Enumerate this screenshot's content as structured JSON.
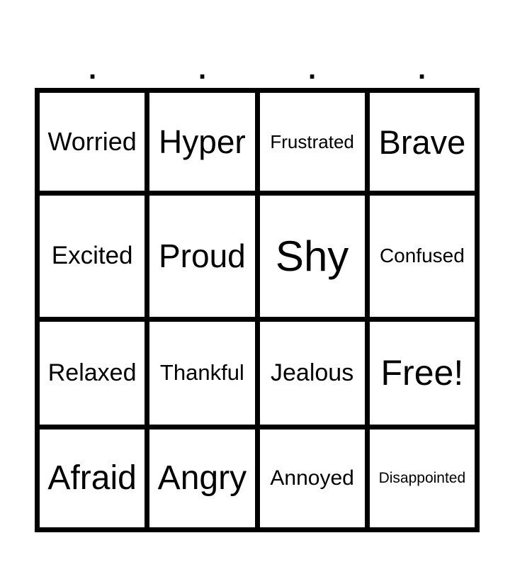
{
  "header": {
    "columns": [
      ".",
      ".",
      ".",
      "."
    ]
  },
  "board": {
    "rows": [
      [
        {
          "text": "Worried",
          "size": "m"
        },
        {
          "text": "Hyper",
          "size": "l"
        },
        {
          "text": "Frustrated",
          "size": "s"
        },
        {
          "text": "Brave",
          "size": "l"
        }
      ],
      [
        {
          "text": "Excited",
          "size": "m"
        },
        {
          "text": "Proud",
          "size": "l"
        },
        {
          "text": "Shy",
          "size": "xl"
        },
        {
          "text": "Confused",
          "size": "s"
        }
      ],
      [
        {
          "text": "Relaxed",
          "size": "m"
        },
        {
          "text": "Thankful",
          "size": "s"
        },
        {
          "text": "Jealous",
          "size": "m"
        },
        {
          "text": "Free!",
          "size": "xl"
        }
      ],
      [
        {
          "text": "Afraid",
          "size": "l"
        },
        {
          "text": "Angry",
          "size": "l"
        },
        {
          "text": "Annoyed",
          "size": "s"
        },
        {
          "text": "Disappointed",
          "size": "xs"
        }
      ]
    ]
  }
}
